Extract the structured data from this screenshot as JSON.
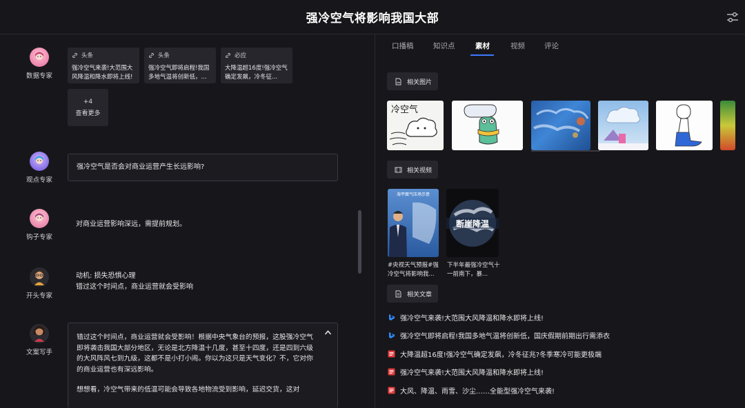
{
  "header": {
    "title": "强冷空气将影响我国大部"
  },
  "left": {
    "agents": [
      {
        "name": "数据专家"
      },
      {
        "name": "观点专家"
      },
      {
        "name": "钩子专家"
      },
      {
        "name": "开头专家"
      },
      {
        "name": "文案写手"
      }
    ],
    "source_cards": [
      {
        "tag": "头条",
        "text": "强冷空气来袭!大范围大风降温和降水即将上线!"
      },
      {
        "tag": "头条",
        "text": "强冷空气即将启程!我国多地气温将创新低，..."
      },
      {
        "tag": "必应",
        "text": "大降温超16度!强冷空气确定发飙，冷冬征..."
      }
    ],
    "more": {
      "count": "+4",
      "label": "查看更多"
    },
    "viewpoint_text": "强冷空气是否会对商业运营产生长远影响?",
    "hook_text": "对商业运营影响深远，需提前规划。",
    "opening_line1": "动机: 损失恐惧心理",
    "opening_line2": "错过这个时间点，商业运营就会受影响",
    "copy_para1": "错过这个时间点，商业运营就会受影响！根据中央气象台的预报，这股强冷空气即将袭击我国大部分地区，无论是北方降温十几度，甚至十四度，还是四到六级的大风阵风七到九级，这都不是小打小闹。你以为这只是天气变化？不，它对你的商业运营也有深远影响。",
    "copy_para2": "想想看，冷空气带来的低温可能会导致各地物流受到影响，延迟交货，这对"
  },
  "right": {
    "tabs": [
      "口播稿",
      "知识点",
      "素材",
      "视频",
      "评论"
    ],
    "active_tab": 2,
    "images_label": "相关图片",
    "videos_label": "相关视频",
    "articles_label": "相关文章",
    "image_texts": {
      "cold_air": "冷空气"
    },
    "videos": [
      {
        "caption": "#央视天气预报#强冷空气将影响我...",
        "overlay": "海平面气压场示意"
      },
      {
        "caption": "下半年最强冷空气十一前南下，暴...",
        "overlay": "断崖降温"
      }
    ],
    "articles": [
      {
        "source": "bing",
        "title": "强冷空气来袭!大范围大风降温和降水即将上线!"
      },
      {
        "source": "bing",
        "title": "强冷空气即将启程!我国多地气温将创新低，国庆假期前期出行需添衣"
      },
      {
        "source": "toutiao",
        "title": "大降温超16度!强冷空气确定发飙，冷冬征兆?冬季寒冷可能更极端"
      },
      {
        "source": "toutiao",
        "title": "强冷空气来袭!大范围大风降温和降水即将上线!"
      },
      {
        "source": "toutiao",
        "title": "大风、降温、雨雪、沙尘……全能型强冷空气来袭!"
      }
    ],
    "colors": {
      "accent": "#3d7bff",
      "bing": "#2f8cff",
      "toutiao": "#e23b3b"
    }
  }
}
